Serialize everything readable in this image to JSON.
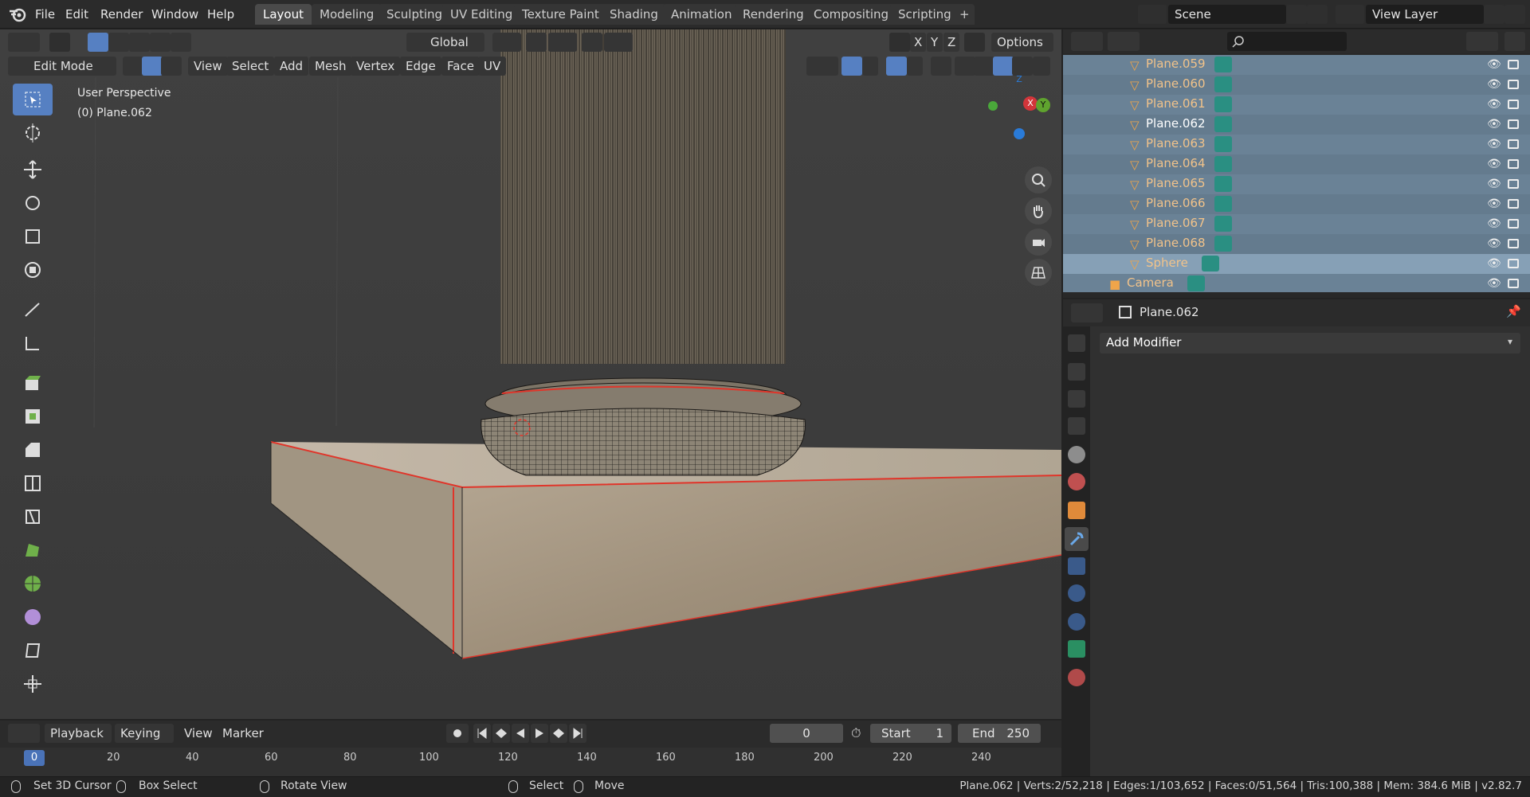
{
  "menu": {
    "file": "File",
    "edit": "Edit",
    "render": "Render",
    "window": "Window",
    "help": "Help"
  },
  "workspaces": [
    "Layout",
    "Modeling",
    "Sculpting",
    "UV Editing",
    "Texture Paint",
    "Shading",
    "Animation",
    "Rendering",
    "Compositing",
    "Scripting"
  ],
  "scene": {
    "scene_name": "Scene",
    "view_layer": "View Layer"
  },
  "viewport": {
    "mode": "Edit Mode",
    "header_menus": [
      "View",
      "Select",
      "Add",
      "Mesh",
      "Vertex",
      "Edge",
      "Face",
      "UV"
    ],
    "orientation": "Global",
    "axes": [
      "X",
      "Y",
      "Z"
    ],
    "options": "Options",
    "view_name": "User Perspective",
    "object_info": "(0) Plane.062",
    "gizmo": {
      "x": "X",
      "y": "Y",
      "z": "Z"
    }
  },
  "outliner": {
    "rows": [
      {
        "label": "Plane.059",
        "state": "normal"
      },
      {
        "label": "Plane.060",
        "state": "alt"
      },
      {
        "label": "Plane.061",
        "state": "normal"
      },
      {
        "label": "Plane.062",
        "state": "active"
      },
      {
        "label": "Plane.063",
        "state": "normal"
      },
      {
        "label": "Plane.064",
        "state": "alt"
      },
      {
        "label": "Plane.065",
        "state": "normal"
      },
      {
        "label": "Plane.066",
        "state": "alt"
      },
      {
        "label": "Plane.067",
        "state": "normal"
      },
      {
        "label": "Plane.068",
        "state": "alt"
      },
      {
        "label": "Sphere",
        "state": "sel"
      },
      {
        "label": "Camera",
        "state": "camera"
      }
    ]
  },
  "properties": {
    "object": "Plane.062",
    "add_modifier": "Add Modifier"
  },
  "timeline": {
    "menus": [
      "Playback",
      "Keying",
      "View",
      "Marker"
    ],
    "current_frame": "0",
    "start_label": "Start",
    "start": "1",
    "end_label": "End",
    "end": "250",
    "ticks": [
      "0",
      "20",
      "40",
      "60",
      "80",
      "100",
      "120",
      "140",
      "160",
      "180",
      "200",
      "220",
      "240"
    ]
  },
  "status": {
    "set_cursor": "Set 3D Cursor",
    "box_select": "Box Select",
    "rotate": "Rotate View",
    "select": "Select",
    "move": "Move",
    "stats": "Plane.062 | Verts:2/52,218 | Edges:1/103,652 | Faces:0/51,564 | Tris:100,388 | Mem: 384.6 MiB | v2.82.7"
  },
  "colors": {
    "accent": "#5680c2",
    "selected_edge": "#e0352a",
    "object_label": "#f2c38a",
    "outliner_bg": "#6a8296"
  }
}
